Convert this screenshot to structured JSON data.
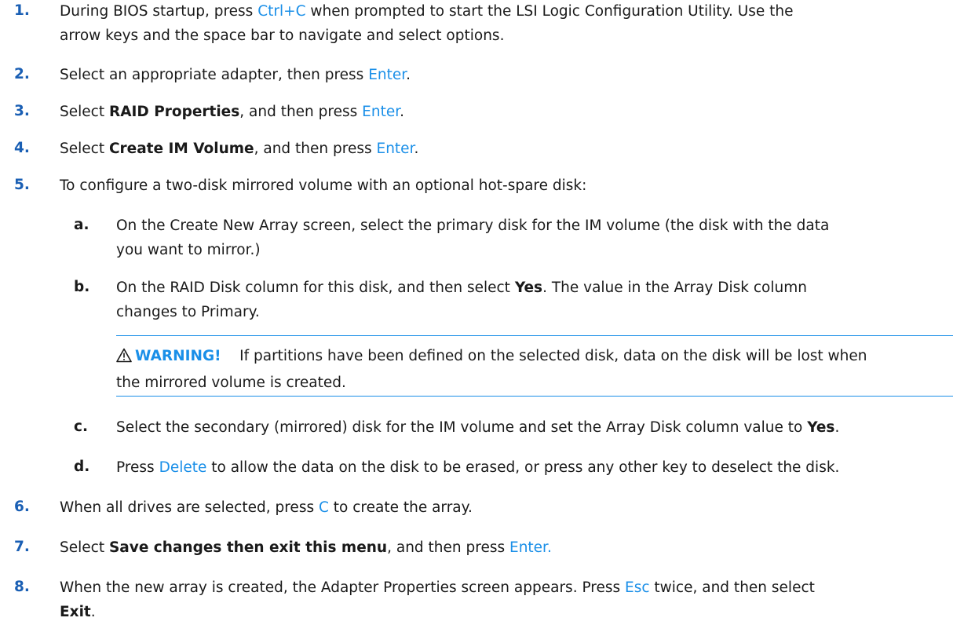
{
  "steps": [
    {
      "num": "1.",
      "p1": "During BIOS startup, press ",
      "key": "Ctrl+C",
      "p2": " when prompted to start the LSI Logic Configuration Utility. Use the",
      "line2": "arrow keys and the space bar to navigate and select options."
    },
    {
      "num": "2.",
      "p1": "Select an appropriate adapter, then press ",
      "key": "Enter",
      "p2": "."
    },
    {
      "num": "3.",
      "p1": "Select ",
      "bold": "RAID Properties",
      "p2": ", and then press ",
      "key": "Enter",
      "p3": "."
    },
    {
      "num": "4.",
      "p1": "Select ",
      "bold": "Create IM Volume",
      "p2": ", and then press ",
      "key": "Enter",
      "p3": "."
    },
    {
      "num": "5.",
      "p1": "To configure a two-disk mirrored volume with an optional hot-spare disk:"
    },
    {
      "num": "6.",
      "p1": "When all drives are selected, press ",
      "key": "C",
      "p2": " to create the array."
    },
    {
      "num": "7.",
      "p1": "Select ",
      "bold": "Save changes then exit this menu",
      "p2": ", and then press ",
      "key": "Enter."
    },
    {
      "num": "8.",
      "p1": "When the new array is created, the Adapter Properties screen appears. Press ",
      "key": "Esc",
      "p2": " twice, and then select",
      "bold": "Exit",
      "p3": "."
    }
  ],
  "substeps": [
    {
      "num": "a.",
      "line1": "On the Create New Array screen, select the primary disk for the IM volume (the disk with the data",
      "line2": "you want to mirror.)"
    },
    {
      "num": "b.",
      "p1": "On the RAID Disk column for this disk, and then select ",
      "bold": "Yes",
      "p2": ". The value in the Array Disk column",
      "line2": "changes to Primary."
    },
    {
      "num": "c.",
      "p1": "Select the secondary (mirrored) disk for the IM volume and set the Array Disk column value to ",
      "bold": "Yes",
      "p2": "."
    },
    {
      "num": "d.",
      "p1": "Press ",
      "key": "Delete",
      "p2": " to allow the data on the disk to be erased, or press any other key to deselect the disk."
    }
  ],
  "warning": {
    "label": "WARNING!",
    "line1": "If partitions have been defined on the selected disk, data on the disk will be lost when",
    "line2": "the mirrored volume is created."
  },
  "colors": {
    "step_number": "#1a5fb4",
    "key_text": "#1a8fe8",
    "warning": "#1a8fe8"
  }
}
